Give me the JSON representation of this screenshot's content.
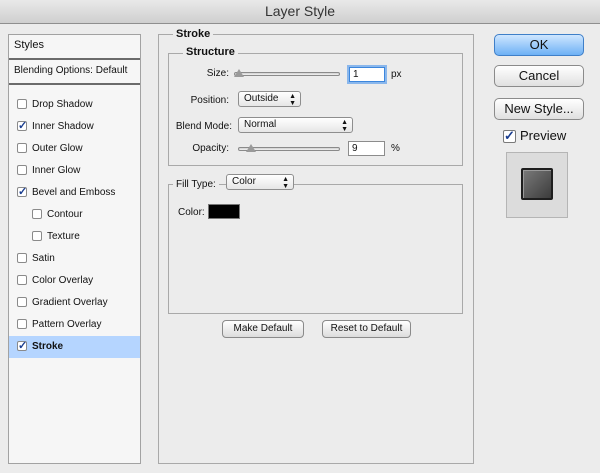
{
  "window": {
    "title": "Layer Style"
  },
  "sidebar": {
    "header": "Styles",
    "blending": "Blending Options: Default",
    "items": [
      {
        "label": "Drop Shadow",
        "checked": false,
        "indent": false,
        "selected": false
      },
      {
        "label": "Inner Shadow",
        "checked": true,
        "indent": false,
        "selected": false
      },
      {
        "label": "Outer Glow",
        "checked": false,
        "indent": false,
        "selected": false
      },
      {
        "label": "Inner Glow",
        "checked": false,
        "indent": false,
        "selected": false
      },
      {
        "label": "Bevel and Emboss",
        "checked": true,
        "indent": false,
        "selected": false
      },
      {
        "label": "Contour",
        "checked": false,
        "indent": true,
        "selected": false
      },
      {
        "label": "Texture",
        "checked": false,
        "indent": true,
        "selected": false
      },
      {
        "label": "Satin",
        "checked": false,
        "indent": false,
        "selected": false
      },
      {
        "label": "Color Overlay",
        "checked": false,
        "indent": false,
        "selected": false
      },
      {
        "label": "Gradient Overlay",
        "checked": false,
        "indent": false,
        "selected": false
      },
      {
        "label": "Pattern Overlay",
        "checked": false,
        "indent": false,
        "selected": false
      },
      {
        "label": "Stroke",
        "checked": true,
        "indent": false,
        "selected": true
      }
    ]
  },
  "stroke": {
    "section_title": "Stroke",
    "structure": {
      "title": "Structure",
      "size_label": "Size:",
      "size_value": "1",
      "size_unit": "px",
      "position_label": "Position:",
      "position_value": "Outside",
      "blend_label": "Blend Mode:",
      "blend_value": "Normal",
      "opacity_label": "Opacity:",
      "opacity_value": "9",
      "opacity_unit": "%"
    },
    "fill": {
      "type_label": "Fill Type:",
      "type_value": "Color",
      "color_label": "Color:",
      "color_hex": "#000000"
    },
    "make_default": "Make Default",
    "reset_default": "Reset to Default"
  },
  "buttons": {
    "ok": "OK",
    "cancel": "Cancel",
    "new_style": "New Style..."
  },
  "preview": {
    "label": "Preview",
    "checked": true
  },
  "colors": {
    "selection": "#b5d5ff",
    "ok_button": "#6eb1f5"
  }
}
